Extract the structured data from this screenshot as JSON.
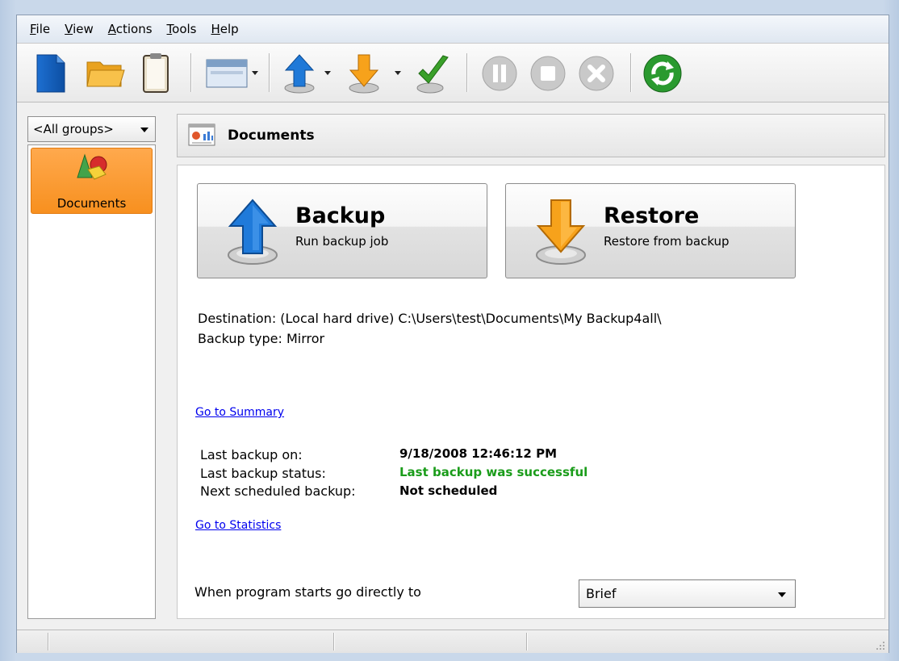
{
  "menu": [
    {
      "ul": "F",
      "rest": "ile"
    },
    {
      "ul": "V",
      "rest": "iew"
    },
    {
      "ul": "A",
      "rest": "ctions"
    },
    {
      "ul": "T",
      "rest": "ools"
    },
    {
      "ul": "H",
      "rest": "elp"
    }
  ],
  "toolbar": {
    "icons": [
      "new-file-icon",
      "open-folder-icon",
      "properties-icon",
      "view-icon",
      "backup-icon",
      "restore-icon",
      "test-icon",
      "pause-icon",
      "stop-icon",
      "cancel-icon",
      "refresh-icon"
    ]
  },
  "groups": {
    "selected": "<All groups>",
    "items": [
      {
        "label": "Documents"
      }
    ]
  },
  "header": {
    "title": "Documents"
  },
  "actions": {
    "backup_title": "Backup",
    "backup_sub": "Run backup job",
    "restore_title": "Restore",
    "restore_sub": "Restore from backup"
  },
  "info": {
    "destination": "Destination: (Local hard drive) C:\\Users\\test\\Documents\\My Backup4all\\",
    "backup_type": "Backup type: Mirror"
  },
  "links": {
    "summary": "Go to Summary",
    "statistics": "Go to Statistics"
  },
  "status": {
    "last_backup_label": "Last backup on:",
    "last_backup_value": "9/18/2008 12:46:12 PM",
    "last_status_label": "Last backup status:",
    "last_status_value": "Last backup was successful",
    "next_label": "Next scheduled backup:",
    "next_value": "Not scheduled"
  },
  "startup": {
    "label": "When program starts go directly to",
    "selected": "Brief"
  },
  "colors": {
    "success": "#1a9c1a",
    "accent": "#f7901f",
    "link": "#0000ee"
  }
}
